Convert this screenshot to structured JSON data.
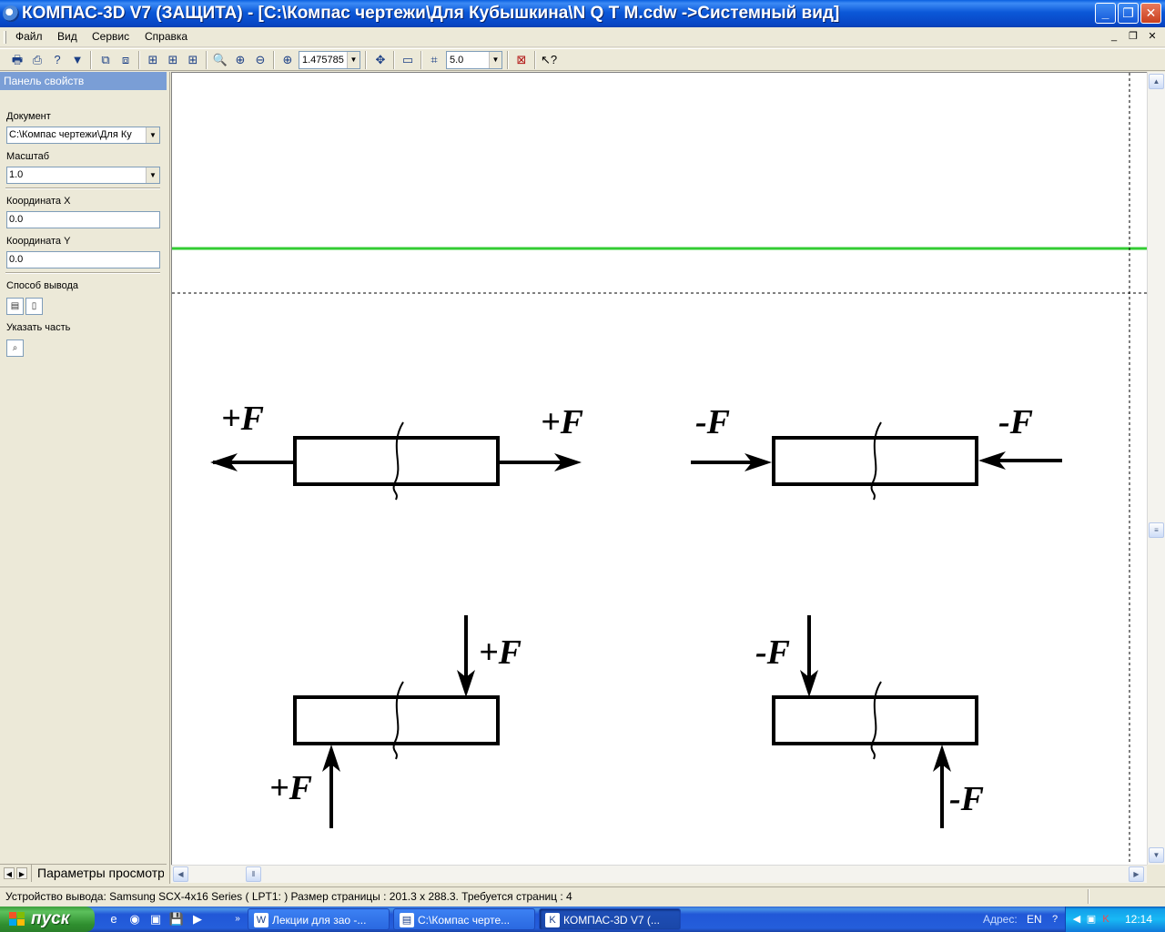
{
  "window": {
    "title": "КОМПАС-3D V7 (ЗАЩИТА) - [C:\\Компас чертежи\\Для Кубышкина\\N Q T M.cdw ->Системный вид]",
    "minimize": "_",
    "maximize": "❐",
    "close": "✕"
  },
  "menu": {
    "items": [
      "Файл",
      "Вид",
      "Сервис",
      "Справка"
    ]
  },
  "toolbar": {
    "zoom_value": "1.475785",
    "step_value": "5.0",
    "icons": [
      "print-icon",
      "print-preview-icon",
      "help-icon",
      "filter-icon",
      "copy-layout-icon",
      "move-sheets-icon",
      "fit-rows-icon",
      "fit-cols-icon",
      "fit-grid-icon",
      "zoom-icon",
      "zoom-in-icon",
      "zoom-out-icon",
      "zoom-scale-icon",
      "pan-icon",
      "show-all-icon",
      "step-icon",
      "close-preview-icon",
      "context-help-icon"
    ]
  },
  "panel": {
    "header": "Панель свойств",
    "document_label": "Документ",
    "document_value": "C:\\Компас чертежи\\Для Ку",
    "scale_label": "Масштаб",
    "scale_value": "1.0",
    "x_label": "Координата X",
    "x_value": "0.0",
    "y_label": "Координата Y",
    "y_value": "0.0",
    "output_label": "Способ вывода",
    "part_label": "Указать часть",
    "tab_label": "Параметры просмотр"
  },
  "drawing": {
    "labels": {
      "tension_left": "+F",
      "tension_right": "+F",
      "compression_left": "-F",
      "compression_right": "-F",
      "shear_pos_top": "+F",
      "shear_pos_bottom": "+F",
      "shear_neg_top": "-F",
      "shear_neg_bottom": "-F"
    },
    "colors": {
      "page_line": "#33cc33",
      "stroke": "#000000"
    }
  },
  "statusbar": {
    "text": "Устройство вывода: Samsung SCX-4x16 Series ( LPT1: )  Размер страницы : 201.3 x 288.3.  Требуется страниц : 4"
  },
  "taskbar": {
    "start": "пуск",
    "tasks": [
      {
        "label": "Лекции для зао -...",
        "icon": "W"
      },
      {
        "label": "C:\\Компас черте...",
        "icon": "▤"
      },
      {
        "label": "КОМПАС-3D V7 (...",
        "icon": "K"
      }
    ],
    "address_label": "Адрес:",
    "language": "EN",
    "clock": "12:14"
  }
}
